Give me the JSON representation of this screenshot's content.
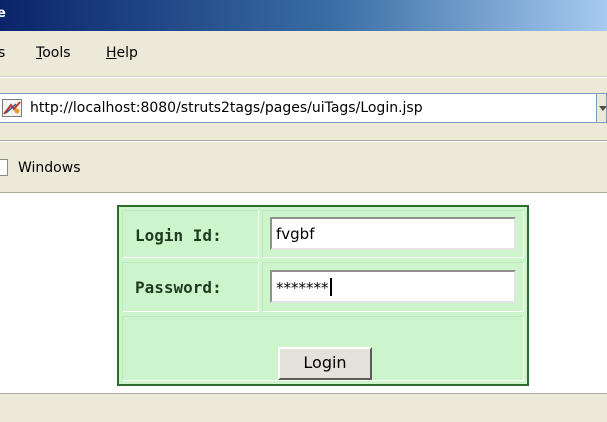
{
  "window": {
    "title_fragment": "e"
  },
  "menu": {
    "items": [
      {
        "before": "",
        "accel": "",
        "after": "s"
      },
      {
        "before": "",
        "accel": "T",
        "after": "ools"
      },
      {
        "before": "",
        "accel": "H",
        "after": "elp"
      }
    ]
  },
  "address_bar": {
    "url": "http://localhost:8080/struts2tags/pages/uiTags/Login.jsp"
  },
  "links_bar": {
    "link_label": "Windows"
  },
  "login_form": {
    "login_id_label": "Login Id:",
    "login_id_value": "fvgbf",
    "password_label": "Password:",
    "password_value": "*******",
    "submit_label": "Login"
  },
  "colors": {
    "form_background": "#ccf5cc",
    "form_border": "#2e6b2e",
    "chrome": "#ece9d8",
    "title_gradient_start": "#0a246a"
  }
}
